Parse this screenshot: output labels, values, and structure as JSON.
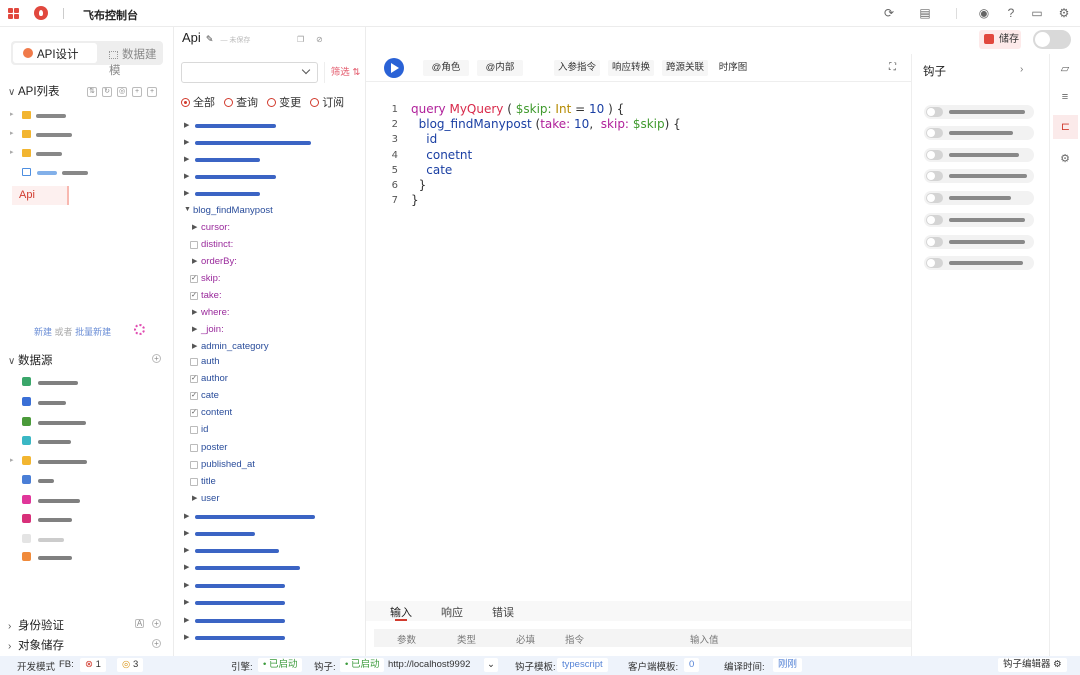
{
  "topbar": {
    "app_title": "飞布控制台",
    "icons": [
      "apps-grid-icon",
      "logo-flame-icon",
      "refresh-icon",
      "document-check-icon",
      "github-icon",
      "help-icon",
      "message-icon",
      "settings-icon"
    ]
  },
  "sidebar": {
    "tabs": {
      "active": "API设计",
      "inactive": "数据建模"
    },
    "api_list_title": "API列表",
    "selected_api": "Api",
    "new_link": "新建",
    "or_text": "或者",
    "batch_new_link": "批量新建",
    "datasource_title": "数据源",
    "auth_title": "身份验证",
    "storage_title": "对象储存"
  },
  "editor_header": {
    "api_name": "Api",
    "unsaved": "— 未保存",
    "save_label": "储存"
  },
  "schema": {
    "filter_label": "筛选",
    "radios": [
      "全部",
      "查询",
      "变更",
      "订阅"
    ],
    "radio_selected": "全部",
    "query_name": "blog_findManypost",
    "fields": [
      {
        "name": "cursor:",
        "kind": "arg-expand"
      },
      {
        "name": "distinct:",
        "kind": "arg-check",
        "checked": false
      },
      {
        "name": "orderBy:",
        "kind": "arg-expand"
      },
      {
        "name": "skip:",
        "kind": "arg-check",
        "checked": true
      },
      {
        "name": "take:",
        "kind": "arg-check",
        "checked": true
      },
      {
        "name": "where:",
        "kind": "arg-expand"
      },
      {
        "name": "_join:",
        "kind": "arg-expand"
      },
      {
        "name": "admin_category",
        "kind": "field-expand"
      },
      {
        "name": "auth",
        "kind": "field-check",
        "checked": false
      },
      {
        "name": "author",
        "kind": "field-check",
        "checked": true
      },
      {
        "name": "cate",
        "kind": "field-check",
        "checked": true
      },
      {
        "name": "content",
        "kind": "field-check",
        "checked": true
      },
      {
        "name": "id",
        "kind": "field-check",
        "checked": false
      },
      {
        "name": "poster",
        "kind": "field-check",
        "checked": false
      },
      {
        "name": "published_at",
        "kind": "field-check",
        "checked": false
      },
      {
        "name": "title",
        "kind": "field-check",
        "checked": false
      },
      {
        "name": "user",
        "kind": "field-expand"
      }
    ]
  },
  "toolbar": {
    "role_btn": "@角色",
    "internal_btn": "@内部",
    "input_directive": "入参指令",
    "response_transform": "响应转换",
    "cross_source": "跨源关联",
    "sequence": "时序图"
  },
  "code": {
    "line_numbers": [
      "1",
      "2",
      "3",
      "4",
      "5",
      "6",
      "7"
    ],
    "l1_query": "query",
    "l1_name": "MyQuery",
    "l1_open": "(",
    "l1_var": "$skip:",
    "l1_type": "Int",
    "l1_eq": "=",
    "l1_val": "10",
    "l1_close": ") {",
    "l2_field": "blog_findManypost",
    "l2_open": "(",
    "l2_take": "take:",
    "l2_take_val": "10",
    "l2_comma": ",",
    "l2_skip": "skip:",
    "l2_skip_var": "$skip",
    "l2_close": ") {",
    "l3": "id",
    "l4": "conetnt",
    "l5": "cate",
    "l6": "}",
    "l7": "}"
  },
  "bottom_tabs": [
    "输入",
    "响应",
    "错误"
  ],
  "param_columns": [
    "参数",
    "类型",
    "必填",
    "指令",
    "输入值"
  ],
  "hooks": {
    "title": "钩子",
    "count": 8
  },
  "status": {
    "mode": "开发模式",
    "fb_label": "FB:",
    "errors": "1",
    "warnings": "3",
    "engine_label": "引擎:",
    "engine_state": "已启动",
    "hook_label": "钩子:",
    "hook_state": "已启动",
    "hook_url": "http://localhost9992",
    "template_label": "钩子模板:",
    "template_value": "typescript",
    "client_template_label": "客户端模板:",
    "client_template_value": "0",
    "compile_label": "编译时间:",
    "compile_value": "刚刚",
    "hook_editor": "钩子编辑器"
  },
  "colors": {
    "accent": "#d13b2e",
    "run": "#2a62d6",
    "schema_bar": "#3b64c4",
    "status_bg": "#eef3fb"
  }
}
